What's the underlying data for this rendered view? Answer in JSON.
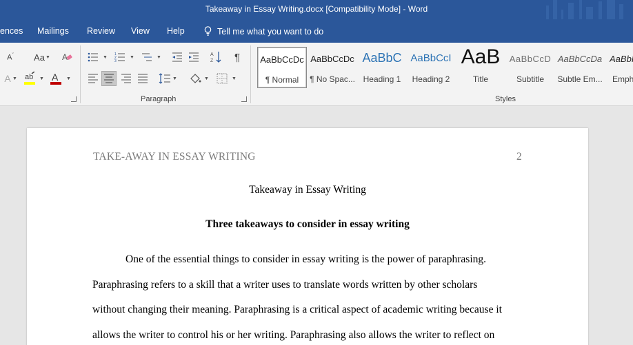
{
  "window": {
    "title": "Takeaway in Essay Writing.docx [Compatibility Mode]  -  Word"
  },
  "menu": {
    "items": [
      "ences",
      "Mailings",
      "Review",
      "View",
      "Help"
    ],
    "tell_me": "Tell me what you want to do"
  },
  "ribbon": {
    "font_group": {
      "change_case_label": "Aa",
      "font_color": "#c00000",
      "highlight_color": "#ffff00"
    },
    "paragraph_group": {
      "label": "Paragraph"
    },
    "styles_group": {
      "label": "Styles",
      "items": [
        {
          "preview": "AaBbCcDc",
          "name": "¶ Normal"
        },
        {
          "preview": "AaBbCcDc",
          "name": "¶ No Spac..."
        },
        {
          "preview": "AaBbC",
          "name": "Heading 1"
        },
        {
          "preview": "AaBbCcI",
          "name": "Heading 2"
        },
        {
          "preview": "AaB",
          "name": "Title"
        },
        {
          "preview": "AaBbCcD",
          "name": "Subtitle"
        },
        {
          "preview": "AaBbCcDa",
          "name": "Subtle Em..."
        },
        {
          "preview": "AaBbI",
          "name": "Emph"
        }
      ]
    }
  },
  "document": {
    "running_head": "TAKE-AWAY IN ESSAY WRITING",
    "page_number": "2",
    "title": "Takeaway in Essay Writing",
    "heading": "Three takeaways to consider in essay writing",
    "lines": [
      "One of the essential things to consider in essay writing is the power of paraphrasing.",
      "Paraphrasing refers to a skill that a writer uses to translate words written by other scholars",
      "without changing their meaning. Paraphrasing is a critical aspect of academic writing because it",
      "allows the writer to control his or her writing. Paraphrasing also allows the writer to reflect on"
    ]
  },
  "colors": {
    "title_bar": "#2b579a",
    "ribbon": "#f3f3f3",
    "canvas": "#e6e6e6",
    "header_text": "#7a7a7a"
  }
}
